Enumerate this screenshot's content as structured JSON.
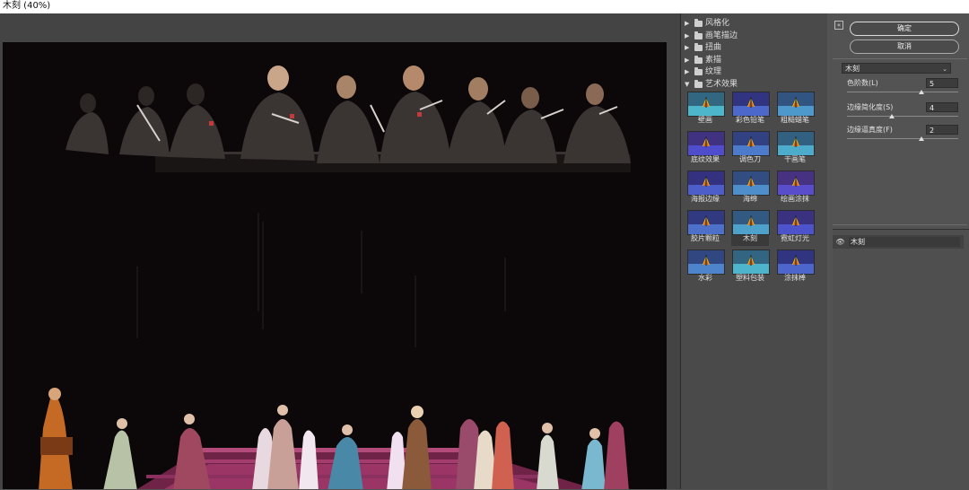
{
  "window": {
    "title": "木刻 (40%)"
  },
  "gallery": {
    "categories": [
      {
        "label": "风格化",
        "expanded": false
      },
      {
        "label": "画笔描边",
        "expanded": false
      },
      {
        "label": "扭曲",
        "expanded": false
      },
      {
        "label": "素描",
        "expanded": false
      },
      {
        "label": "纹理",
        "expanded": false
      },
      {
        "label": "艺术效果",
        "expanded": true
      }
    ],
    "filters": [
      {
        "label": "壁画"
      },
      {
        "label": "彩色铅笔"
      },
      {
        "label": "粗糙蜡笔"
      },
      {
        "label": "底纹效果"
      },
      {
        "label": "调色刀"
      },
      {
        "label": "干画笔"
      },
      {
        "label": "海报边缘"
      },
      {
        "label": "海绵"
      },
      {
        "label": "绘画涂抹"
      },
      {
        "label": "胶片颗粒"
      },
      {
        "label": "木刻",
        "selected": true
      },
      {
        "label": "霓虹灯光"
      },
      {
        "label": "水彩"
      },
      {
        "label": "塑料包装"
      },
      {
        "label": "涂抹棒"
      }
    ]
  },
  "controls": {
    "ok_label": "确定",
    "cancel_label": "取消",
    "collapse_label": "«",
    "filter_select": "木刻",
    "params": [
      {
        "label": "色阶数(L)",
        "value": "5",
        "fraction": 0.67
      },
      {
        "label": "边缘简化度(S)",
        "value": "4",
        "fraction": 0.4
      },
      {
        "label": "边缘逼真度(F)",
        "value": "2",
        "fraction": 0.67
      }
    ]
  },
  "layers": [
    {
      "name": "木刻",
      "visible": true
    }
  ],
  "colors": {
    "background": "#535353",
    "preview_bg": "#0c0708",
    "stage": "#8a2d57"
  }
}
